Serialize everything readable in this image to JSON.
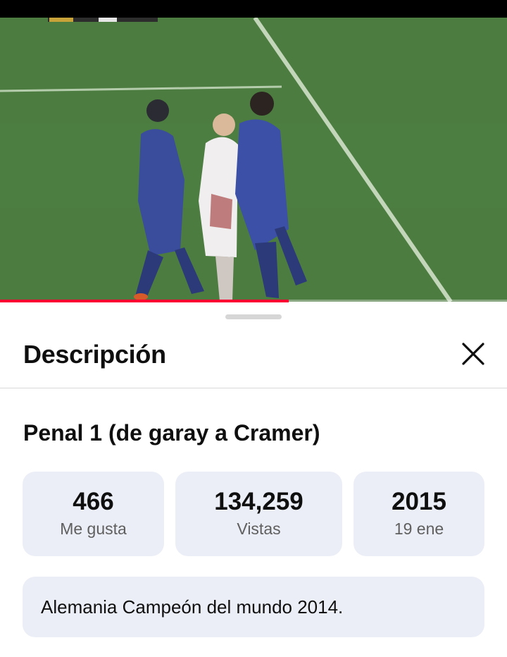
{
  "video": {
    "progress_fraction": 0.57
  },
  "sheet": {
    "title": "Descripción",
    "close_icon": "close-icon"
  },
  "video_title": "Penal 1 (de garay a Cramer)",
  "stats": {
    "likes": {
      "value": "466",
      "label": "Me gusta"
    },
    "views": {
      "value": "134,259",
      "label": "Vistas"
    },
    "date": {
      "value": "2015",
      "label": "19 ene"
    }
  },
  "description": "Alemania Campeón del mundo 2014.",
  "colors": {
    "progress": "#ff0033",
    "card_bg": "#ebeef6"
  }
}
